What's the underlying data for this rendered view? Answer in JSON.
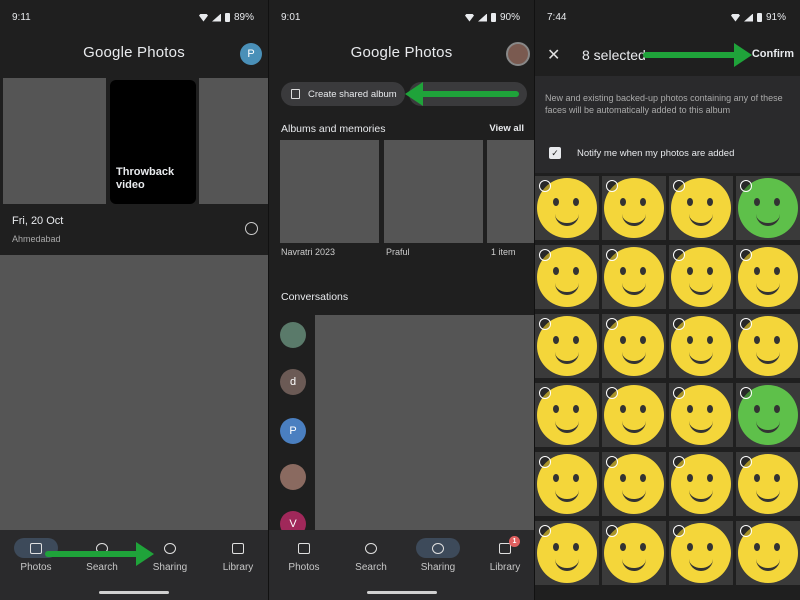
{
  "panel1": {
    "status": {
      "time": "9:11",
      "battery": "89%"
    },
    "app_title": "Google Photos",
    "avatar_initial": "P",
    "throwback_label": "Throwback video",
    "date_label": "Fri, 20 Oct",
    "location_label": "Ahmedabad",
    "nav": {
      "photos": "Photos",
      "search": "Search",
      "sharing": "Sharing",
      "library": "Library"
    }
  },
  "panel2": {
    "status": {
      "time": "9:01",
      "battery": "90%"
    },
    "app_title": "Google Photos",
    "create_shared_album": "Create shared album",
    "albums_heading": "Albums and memories",
    "view_all": "View all",
    "albums": [
      {
        "name": "Navratri 2023"
      },
      {
        "name": "Praful"
      },
      {
        "name": "1 item"
      }
    ],
    "conversations_heading": "Conversations",
    "conversation_avatars": [
      "",
      "d",
      "P",
      "",
      "V"
    ],
    "nav": {
      "photos": "Photos",
      "search": "Search",
      "sharing": "Sharing",
      "library": "Library",
      "library_badge": "1"
    }
  },
  "panel3": {
    "status": {
      "time": "7:44",
      "battery": "91%"
    },
    "selected_count": "8 selected",
    "confirm_label": "Confirm",
    "description": "New and existing backed-up photos containing any of these faces will be automatically added to this album",
    "notify_label": "Notify me when my photos are added"
  },
  "colors": {
    "accent_arrow": "#1fa33a",
    "avatar_blue": "#4a90b8",
    "emoji_yellow": "#f4d63a",
    "emoji_green": "#5ec04a"
  }
}
